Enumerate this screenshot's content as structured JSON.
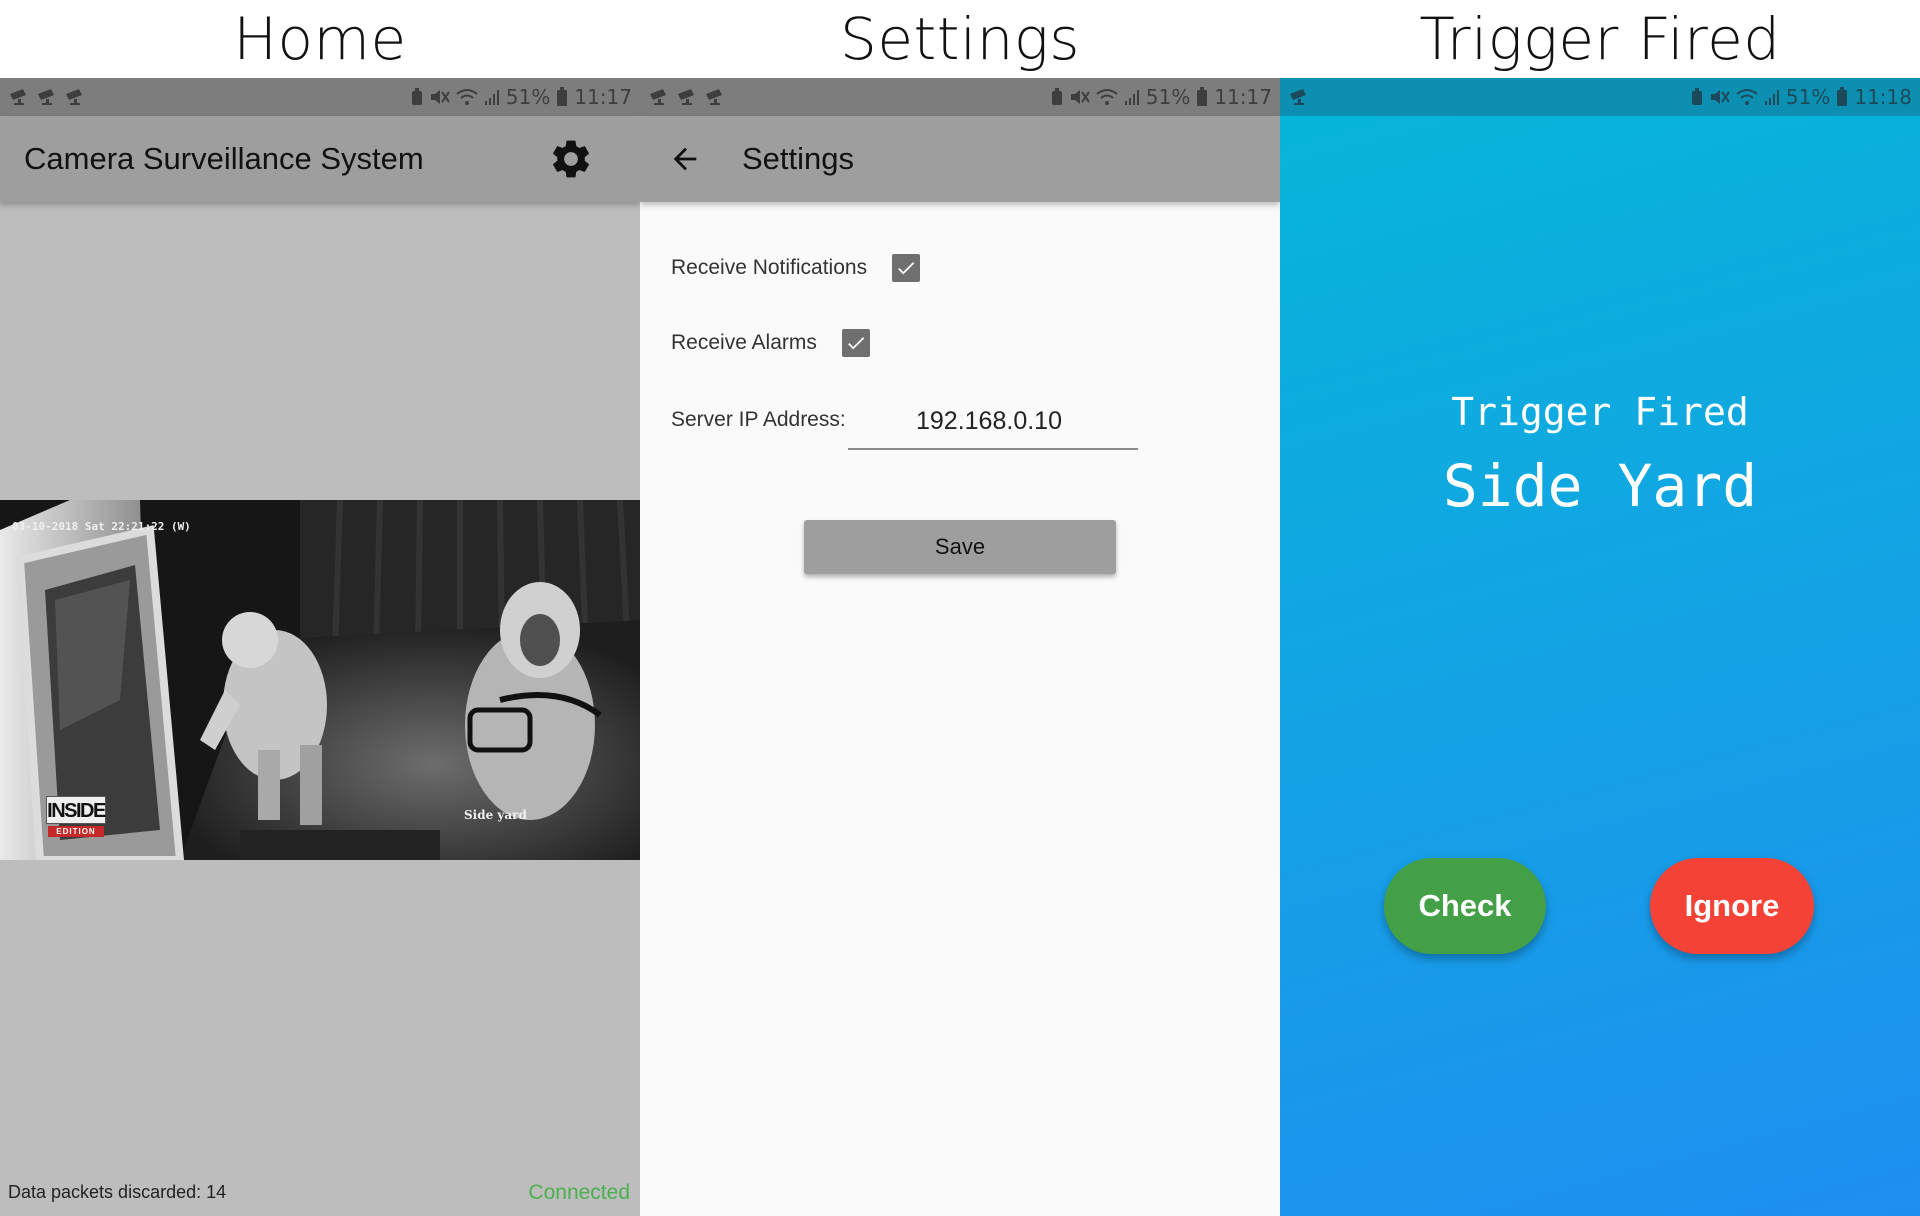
{
  "captions": {
    "home": "Home",
    "settings": "Settings",
    "trigger": "Trigger Fired"
  },
  "home": {
    "statusbar": {
      "battery_pct": "51%",
      "time": "11:17",
      "notif_icons": [
        "cctv-icon",
        "cctv-icon",
        "cctv-icon"
      ]
    },
    "title": "Camera Surveillance System",
    "settings_icon": "gear-icon",
    "video": {
      "timestamp": "03-10-2018 Sat 22:21:22 (W)",
      "camera_label": "Side yard",
      "logo_text": "INSIDE",
      "logo_sub": "EDITION"
    },
    "footer": {
      "discarded": "Data packets discarded: 14",
      "status": "Connected",
      "status_color": "#4caf50"
    }
  },
  "settings": {
    "statusbar": {
      "battery_pct": "51%",
      "time": "11:17",
      "notif_icons": [
        "cctv-icon",
        "cctv-icon",
        "cctv-icon"
      ]
    },
    "title": "Settings",
    "back_icon": "arrow-left-icon",
    "receive_notifications": {
      "label": "Receive Notifications",
      "checked": true
    },
    "receive_alarms": {
      "label": "Receive Alarms",
      "checked": true
    },
    "server_ip": {
      "label": "Server IP Address:",
      "value": "192.168.0.10"
    },
    "save_label": "Save"
  },
  "trigger": {
    "statusbar": {
      "battery_pct": "51%",
      "time": "11:18",
      "notif_icons": [
        "cctv-icon"
      ]
    },
    "line1": "Trigger Fired",
    "line2": "Side Yard",
    "check_label": "Check",
    "check_color": "#43a047",
    "ignore_label": "Ignore",
    "ignore_color": "#f44336"
  }
}
